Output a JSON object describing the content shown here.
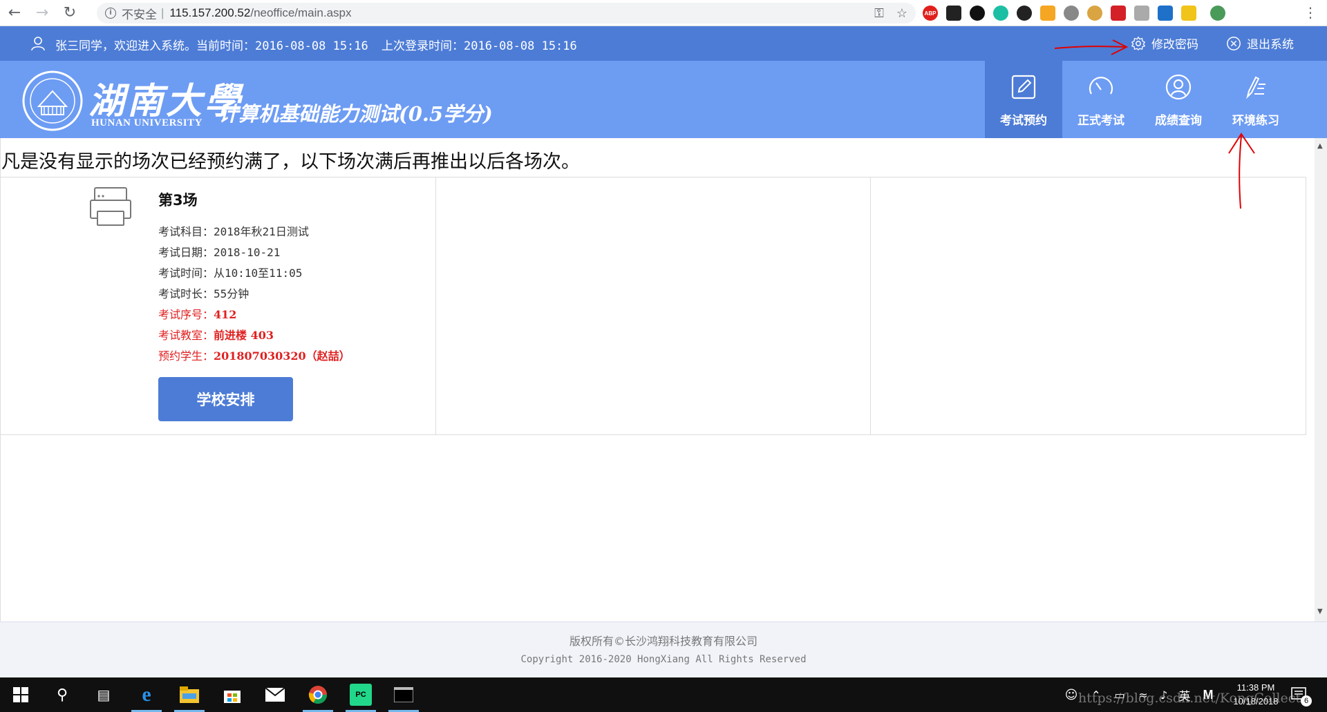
{
  "browser": {
    "security_label": "不安全",
    "url_host": "115.157.200.52",
    "url_path": "/neoffice/main.aspx"
  },
  "topbar": {
    "welcome_prefix": "张三同学，欢迎进入系统。当前时间：",
    "current_time": "2016-08-08 15:16",
    "last_login_prefix": "上次登录时间：",
    "last_login_time": "2016-08-08 15:16",
    "change_password": "修改密码",
    "logout": "退出系统"
  },
  "header": {
    "logo_cn": "湖南大學",
    "logo_en": "HUNAN UNIVERSITY",
    "system_title": "计算机基础能力测试(0.5学分)",
    "nav": [
      {
        "label": "考试预约",
        "icon": "edit-icon",
        "active": true
      },
      {
        "label": "正式考试",
        "icon": "gauge-icon",
        "active": false
      },
      {
        "label": "成绩查询",
        "icon": "user-circle-icon",
        "active": false
      },
      {
        "label": "环境练习",
        "icon": "pen-list-icon",
        "active": false
      }
    ]
  },
  "main": {
    "notice": "凡是没有显示的场次已经预约满了，以下场次满后再推出以后各场次。",
    "session": {
      "title": "第3场",
      "rows": [
        {
          "label": "考试科目：",
          "value": "2018年秋21日测试",
          "highlight": false
        },
        {
          "label": "考试日期：",
          "value": "2018-10-21",
          "highlight": false
        },
        {
          "label": "考试时间：",
          "value": "从10:10至11:05",
          "highlight": false
        },
        {
          "label": "考试时长：",
          "value": "55分钟",
          "highlight": false
        },
        {
          "label": "考试序号：",
          "value": "412",
          "highlight": true
        },
        {
          "label": "考试教室：",
          "value": "前进楼 403",
          "highlight": true
        },
        {
          "label": "预约学生：",
          "value": "201807030320（赵喆）",
          "highlight": true
        }
      ],
      "button": "学校安排"
    }
  },
  "footer": {
    "copyright_cn": "版权所有©长沙鸿翔科技教育有限公司",
    "copyright_en": "Copyright 2016-2020 HongXiang All Rights Reserved"
  },
  "taskbar": {
    "time": "11:38 PM",
    "date": "10/18/2018",
    "ime": "英",
    "notification_count": "6"
  },
  "watermark": "https://blog.csdn.net/KongCollect",
  "colors": {
    "info_bar": "#4d7cd6",
    "header": "#6d9cf3",
    "accent_red": "#e02020",
    "annotation_red": "#e00000"
  }
}
